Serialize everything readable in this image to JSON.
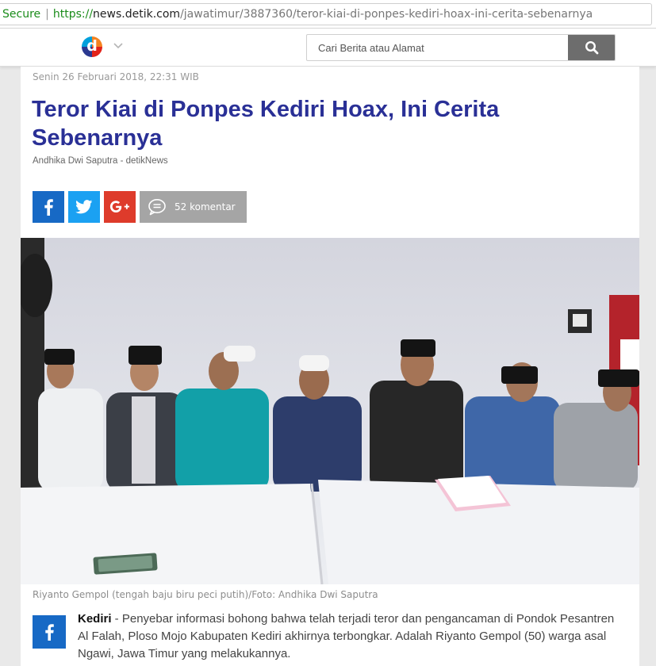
{
  "browser": {
    "secure_label": "Secure",
    "url_scheme": "https://",
    "url_host": "news.detik.com",
    "url_path": "/jawatimur/3887360/teror-kiai-di-ponpes-kediri-hoax-ini-cerita-sebenarnya"
  },
  "header": {
    "logo_letter": "d",
    "search_placeholder": "Cari Berita atau Alamat"
  },
  "article": {
    "date": "Senin 26 Februari 2018, 22:31 WIB",
    "title": "Teror Kiai di Ponpes Kediri Hoax, Ini Cerita Sebenarnya",
    "author": "Andhika Dwi Saputra - detikNews",
    "comments_label": "52 komentar",
    "photo_caption": "Riyanto Gempol (tengah baju biru peci putih)/Foto: Andhika Dwi Saputra",
    "lead_location": "Kediri",
    "lead_text": " - Penyebar informasi bohong bahwa telah terjadi teror dan pengancaman di Pondok Pesantren Al Falah, Ploso Mojo Kabupaten Kediri akhirnya terbongkar. Adalah Riyanto Gempol (50) warga asal Ngawi, Jawa Timur yang melakukannya."
  },
  "colors": {
    "title": "#2a3096",
    "facebook": "#1769c5",
    "twitter": "#1ba1f2",
    "google_plus": "#de3b2b",
    "comments": "#a5a5a5",
    "secure": "#1a8c1a"
  },
  "icons": [
    "detik-logo",
    "chevron-down-icon",
    "search-icon",
    "facebook-icon",
    "twitter-icon",
    "google-plus-icon",
    "comment-icon"
  ]
}
